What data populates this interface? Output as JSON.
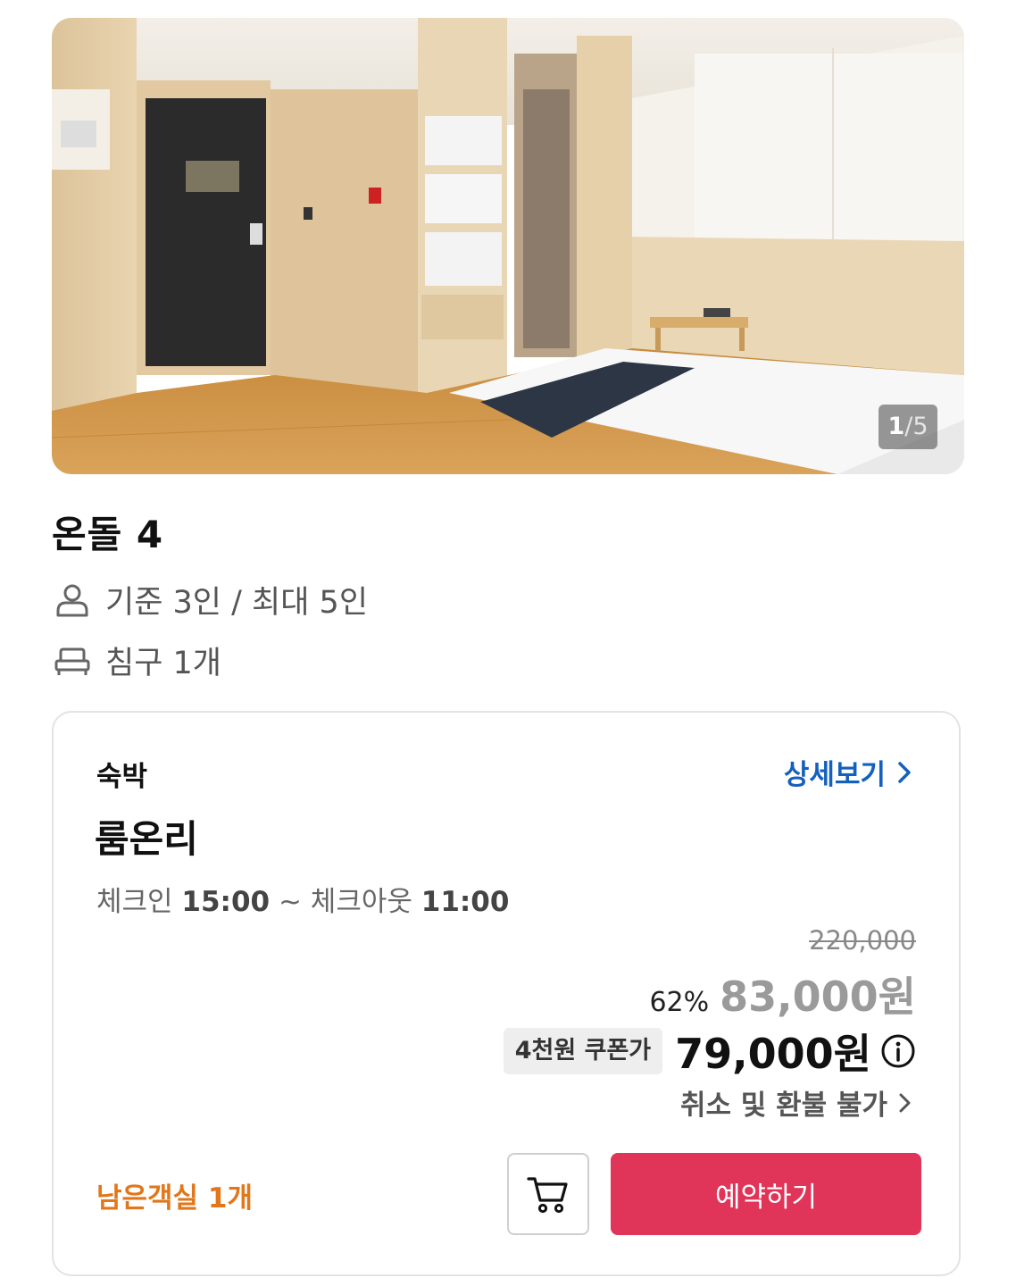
{
  "gallery": {
    "current": "1",
    "separator": "/",
    "total": "5"
  },
  "room": {
    "name": "온돌 4",
    "capacity": "기준 3인 / 최대 5인",
    "bedding": "침구 1개"
  },
  "offer": {
    "stay_type": "숙박",
    "detail_link": "상세보기",
    "plan_name": "룸온리",
    "checkin_label": "체크인",
    "checkin_time": "15:00",
    "checkout_separator": " ~ ",
    "checkout_label": "체크아웃",
    "checkout_time": "11:00",
    "original_price": "220,000",
    "discount_rate": "62%",
    "sale_price": "83,000원",
    "coupon_badge": "4천원 쿠폰가",
    "coupon_price": "79,000원",
    "refund_policy": "취소 및 환불 불가",
    "remaining_rooms": "남은객실 1개",
    "book_button": "예약하기"
  },
  "icons": {
    "person": "person-icon",
    "bed": "bed-icon",
    "chevron": "chevron-right-icon",
    "info": "info-icon",
    "cart": "cart-icon"
  },
  "colors": {
    "link_blue": "#1460bd",
    "book_pink": "#e03459",
    "remaining_orange": "#e1761a"
  }
}
